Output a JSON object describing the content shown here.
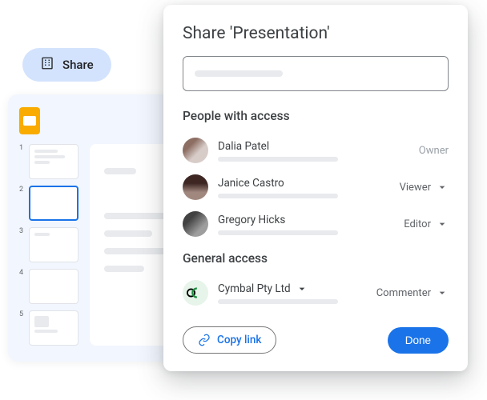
{
  "share_pill": {
    "label": "Share"
  },
  "slides": {
    "thumbs": [
      {
        "num": "1",
        "active": false
      },
      {
        "num": "2",
        "active": true
      },
      {
        "num": "3",
        "active": false
      },
      {
        "num": "4",
        "active": false
      },
      {
        "num": "5",
        "active": false
      }
    ]
  },
  "dialog": {
    "title": "Share 'Presentation'",
    "search_placeholder": "",
    "people_section": "People with access",
    "general_section": "General access",
    "people": [
      {
        "name": "Dalia Patel",
        "role": "Owner",
        "role_type": "owner"
      },
      {
        "name": "Janice Castro",
        "role": "Viewer",
        "role_type": "dropdown"
      },
      {
        "name": "Gregory Hicks",
        "role": "Editor",
        "role_type": "dropdown"
      }
    ],
    "general": {
      "name": "Cymbal Pty Ltd",
      "role": "Commenter"
    },
    "copy_link": "Copy link",
    "done": "Done"
  }
}
